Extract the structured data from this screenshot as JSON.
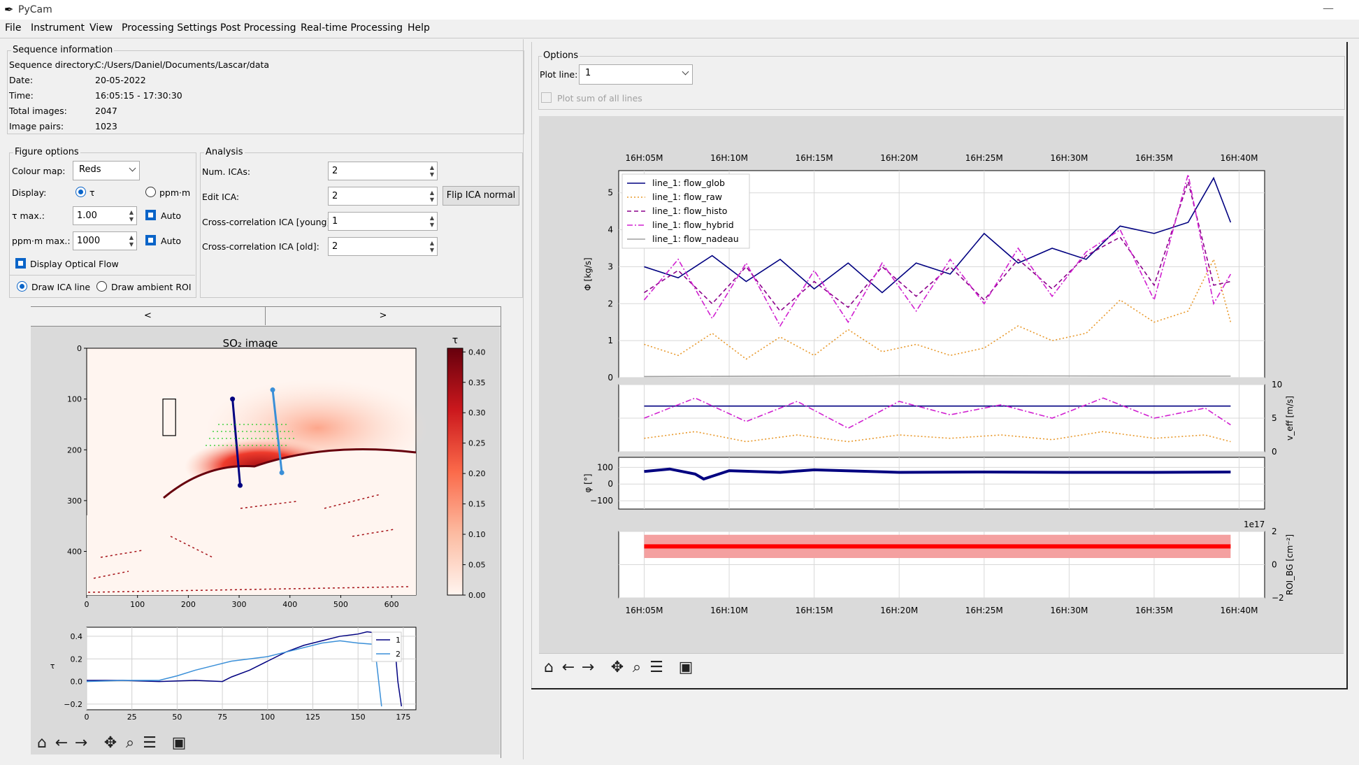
{
  "app": {
    "title": "PyCam",
    "icon": "feather-icon"
  },
  "window_controls": {
    "minimize": "—"
  },
  "menu": [
    "File",
    "Instrument",
    "View",
    "Processing Settings",
    "Post Processing",
    "Real-time Processing",
    "Help"
  ],
  "sequence": {
    "title": "Sequence information",
    "rows": [
      {
        "label": "Sequence directory:",
        "value": "C:/Users/Daniel/Documents/Lascar/data"
      },
      {
        "label": "Date:",
        "value": "20-05-2022"
      },
      {
        "label": "Time:",
        "value": "16:05:15 - 17:30:30"
      },
      {
        "label": "Total images:",
        "value": "2047"
      },
      {
        "label": "Image pairs:",
        "value": "1023"
      }
    ]
  },
  "figure_options": {
    "title": "Figure options",
    "colour_map_label": "Colour map:",
    "colour_map_value": "Reds",
    "display_label": "Display:",
    "display_tau": "τ",
    "display_ppm": "ppm⋅m",
    "tau_max_label": "τ max.:",
    "tau_max_value": "1.00",
    "tau_auto_label": "Auto",
    "ppm_max_label": "ppm⋅m max.:",
    "ppm_max_value": "1000",
    "ppm_auto_label": "Auto",
    "optical_flow_label": "Display Optical Flow",
    "draw_ica_label": "Draw ICA line",
    "draw_roi_label": "Draw ambient ROI"
  },
  "analysis": {
    "title": "Analysis",
    "num_icas_label": "Num. ICAs:",
    "num_icas_value": "2",
    "edit_ica_label": "Edit ICA:",
    "edit_ica_value": "2",
    "flip_button": "Flip ICA normal",
    "xcorr_young_label": "Cross-correlation ICA [young]:",
    "xcorr_young_value": "1",
    "xcorr_old_label": "Cross-correlation ICA [old]:",
    "xcorr_old_value": "2"
  },
  "nav": {
    "prev": "<",
    "next": ">"
  },
  "options": {
    "title": "Options",
    "plot_line_label": "Plot line:",
    "plot_line_value": "1",
    "plot_sum_label": "Plot sum of all lines"
  },
  "toolbar_icons": [
    "home-icon",
    "back-arrow-icon",
    "forward-arrow-icon",
    "pan-icon",
    "zoom-icon",
    "configure-subplots-icon",
    "save-icon"
  ],
  "chart_data": [
    {
      "type": "heatmap",
      "title": "SO₂ image",
      "x_ticks": [
        "0",
        "100",
        "200",
        "300",
        "400",
        "500",
        "600"
      ],
      "y_ticks": [
        "0",
        "100",
        "200",
        "300",
        "400"
      ],
      "colorbar_label": "τ",
      "colorbar_ticks": [
        "0.00",
        "0.05",
        "0.10",
        "0.15",
        "0.20",
        "0.25",
        "0.30",
        "0.35",
        "0.40"
      ],
      "colormap": "Reds",
      "xlim": [
        0,
        648
      ],
      "ylim": [
        486,
        0
      ],
      "ica_lines": [
        {
          "name": "1",
          "color": "#000080",
          "x": [
            287,
            302
          ],
          "y": [
            100,
            270
          ]
        },
        {
          "name": "2",
          "color": "#3a8fd8",
          "x": [
            366,
            384
          ],
          "y": [
            82,
            245
          ]
        }
      ],
      "ambient_roi": {
        "x": [
          150,
          175
        ],
        "y": [
          100,
          172
        ]
      }
    },
    {
      "type": "line",
      "ylabel": "τ",
      "xlim": [
        0,
        182
      ],
      "ylim": [
        -0.25,
        0.48
      ],
      "x_ticks": [
        "0",
        "25",
        "50",
        "75",
        "100",
        "125",
        "150",
        "175"
      ],
      "y_ticks": [
        "−0.2",
        "0.0",
        "0.2",
        "0.4"
      ],
      "legend": [
        "1",
        "2"
      ],
      "series": [
        {
          "name": "1",
          "color": "#000080",
          "x": [
            0,
            20,
            40,
            60,
            75,
            80,
            90,
            100,
            110,
            120,
            130,
            140,
            150,
            155,
            165,
            170,
            172,
            174
          ],
          "y": [
            0.01,
            0.01,
            0.0,
            0.01,
            0.0,
            0.04,
            0.1,
            0.18,
            0.26,
            0.32,
            0.36,
            0.4,
            0.42,
            0.44,
            0.42,
            0.38,
            0.0,
            -0.22
          ]
        },
        {
          "name": "2",
          "color": "#3a8fd8",
          "x": [
            0,
            20,
            40,
            50,
            60,
            70,
            80,
            90,
            100,
            110,
            120,
            130,
            140,
            150,
            158,
            160,
            163
          ],
          "y": [
            0.0,
            0.01,
            0.01,
            0.05,
            0.1,
            0.14,
            0.18,
            0.2,
            0.22,
            0.26,
            0.3,
            0.34,
            0.36,
            0.34,
            0.33,
            0.2,
            -0.22
          ]
        }
      ]
    },
    {
      "type": "line",
      "ylabel": "Φ [kg/s]",
      "x_ticks": [
        "16H:05M",
        "16H:10M",
        "16H:15M",
        "16H:20M",
        "16H:25M",
        "16H:30M",
        "16H:35M",
        "16H:40M"
      ],
      "y_ticks": [
        "0",
        "1",
        "2",
        "3",
        "4",
        "5"
      ],
      "xlim": [
        3.5,
        41.5
      ],
      "ylim": [
        0,
        5.6
      ],
      "legend": [
        "line_1: flow_glob",
        "line_1: flow_raw",
        "line_1: flow_histo",
        "line_1: flow_hybrid",
        "line_1: flow_nadeau"
      ],
      "series": [
        {
          "name": "line_1: flow_glob",
          "color": "#000080",
          "style": "solid",
          "x": [
            5,
            7,
            9,
            11,
            13,
            15,
            17,
            19,
            21,
            23,
            25,
            27,
            29,
            31,
            33,
            35,
            37,
            38.5,
            39.5
          ],
          "y": [
            3.0,
            2.7,
            3.3,
            2.6,
            3.2,
            2.4,
            3.1,
            2.3,
            3.1,
            2.8,
            3.9,
            3.1,
            3.5,
            3.2,
            4.1,
            3.9,
            4.2,
            5.4,
            4.2
          ]
        },
        {
          "name": "line_1: flow_raw",
          "color": "#e8982a",
          "style": "dotted",
          "x": [
            5,
            7,
            9,
            11,
            13,
            15,
            17,
            19,
            21,
            23,
            25,
            27,
            29,
            31,
            33,
            35,
            37,
            38.5,
            39.5
          ],
          "y": [
            0.9,
            0.6,
            1.2,
            0.5,
            1.1,
            0.6,
            1.3,
            0.7,
            0.9,
            0.6,
            0.8,
            1.4,
            1.0,
            1.2,
            2.1,
            1.5,
            1.8,
            3.2,
            1.5
          ]
        },
        {
          "name": "line_1: flow_histo",
          "color": "#8b008b",
          "style": "dashed",
          "x": [
            5,
            7,
            9,
            11,
            13,
            15,
            17,
            19,
            21,
            23,
            25,
            27,
            29,
            31,
            33,
            35,
            37,
            38.5,
            39.5
          ],
          "y": [
            2.3,
            2.9,
            2.0,
            3.0,
            1.8,
            2.6,
            1.9,
            3.0,
            2.2,
            3.0,
            2.1,
            3.2,
            2.4,
            3.3,
            3.8,
            2.5,
            5.3,
            2.5,
            2.6
          ]
        },
        {
          "name": "line_1: flow_hybrid",
          "color": "#d020d0",
          "style": "dashdot",
          "x": [
            5,
            7,
            9,
            11,
            13,
            15,
            17,
            19,
            21,
            23,
            25,
            27,
            29,
            31,
            33,
            35,
            37,
            38.5,
            39.5
          ],
          "y": [
            2.1,
            3.2,
            1.6,
            3.1,
            1.4,
            2.9,
            1.5,
            3.1,
            1.8,
            3.2,
            2.0,
            3.5,
            2.2,
            3.4,
            4.0,
            2.1,
            5.5,
            2.0,
            2.8
          ]
        },
        {
          "name": "line_1: flow_nadeau",
          "color": "#a0a0a0",
          "style": "solid",
          "x": [
            5,
            20,
            39.5
          ],
          "y": [
            0.03,
            0.05,
            0.04
          ]
        }
      ]
    },
    {
      "type": "line",
      "ylabel": "v_eff [m/s]",
      "y_ticks": [
        "0",
        "5",
        "10"
      ],
      "ylim": [
        0,
        10
      ],
      "xlim": [
        3.5,
        41.5
      ],
      "series": [
        {
          "name": "glob",
          "color": "#000080",
          "style": "solid",
          "x": [
            5,
            39.5
          ],
          "y": [
            6.8,
            6.8
          ]
        },
        {
          "name": "hybrid",
          "color": "#d020d0",
          "style": "dashdot",
          "x": [
            5,
            8,
            11,
            14,
            17,
            20,
            23,
            26,
            29,
            32,
            35,
            38,
            39.5
          ],
          "y": [
            5.0,
            8.0,
            4.5,
            7.5,
            3.5,
            7.5,
            5.5,
            7.0,
            5.0,
            8.0,
            5.0,
            6.5,
            4.0
          ]
        },
        {
          "name": "raw",
          "color": "#e8982a",
          "style": "dotted",
          "x": [
            5,
            8,
            11,
            14,
            17,
            20,
            23,
            26,
            29,
            32,
            35,
            38,
            39.5
          ],
          "y": [
            2.0,
            3.0,
            1.5,
            2.5,
            1.5,
            2.5,
            2.0,
            2.5,
            1.8,
            3.0,
            2.0,
            2.5,
            1.5
          ]
        }
      ]
    },
    {
      "type": "line",
      "ylabel": "φ [°]",
      "y_ticks": [
        "100",
        "0",
        "−100"
      ],
      "ylim": [
        -150,
        160
      ],
      "xlim": [
        3.5,
        41.5
      ],
      "series": [
        {
          "name": "angle",
          "color": "#000080",
          "style": "solid",
          "x": [
            5,
            6.5,
            8,
            8.5,
            10,
            13,
            15,
            20,
            25,
            30,
            35,
            39.5
          ],
          "y": [
            75,
            90,
            60,
            30,
            80,
            70,
            85,
            70,
            72,
            70,
            70,
            72
          ]
        }
      ]
    },
    {
      "type": "area",
      "ylabel": "ROI_BG [cm⁻²]",
      "exponent_label": "1e17",
      "y_ticks": [
        "2",
        "0",
        "−2"
      ],
      "ylim": [
        -2,
        2
      ],
      "xlim": [
        3.5,
        41.5
      ],
      "series": [
        {
          "name": "roi",
          "color": "#ff0000",
          "band_color": "#f4a0a0",
          "x": [
            5,
            39.5
          ],
          "y": [
            1.1,
            1.1
          ],
          "band": [
            0.4,
            1.8
          ]
        }
      ]
    }
  ]
}
